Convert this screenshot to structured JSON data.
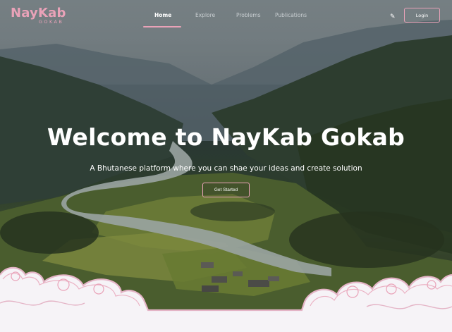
{
  "brand": {
    "title": "NayKab",
    "subtitle": "GOKAB"
  },
  "nav": {
    "items": [
      {
        "label": "Home",
        "active": true
      },
      {
        "label": "Explore",
        "active": false
      },
      {
        "label": "Problems",
        "active": false
      },
      {
        "label": "Publications",
        "active": false
      }
    ],
    "edit_icon": "pencil-icon",
    "login_label": "Login"
  },
  "hero": {
    "headline": "Welcome to NayKab Gokab",
    "subtext": "A Bhutanese platform where you can shae your ideas and create solution",
    "cta_label": "Get Started",
    "background": "valley-landscape-photo"
  },
  "colors": {
    "accent": "#e9a2b8",
    "cloud_border": "#e4b4c6",
    "cloud_fill": "#f6f3f7"
  }
}
